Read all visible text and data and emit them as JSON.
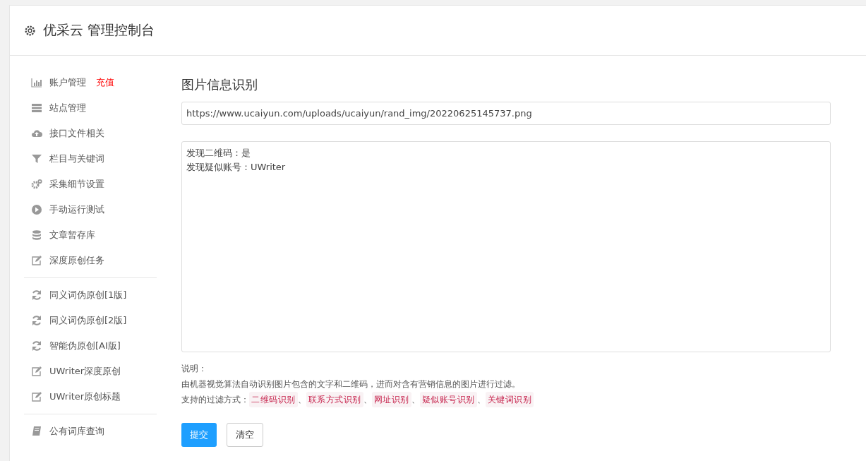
{
  "header": {
    "title": "优采云 管理控制台"
  },
  "sidebar": {
    "groups": [
      [
        {
          "label": "账户管理",
          "badge": "充值"
        },
        {
          "label": "站点管理"
        },
        {
          "label": "接口文件相关"
        },
        {
          "label": "栏目与关键词"
        },
        {
          "label": "采集细节设置"
        },
        {
          "label": "手动运行测试"
        },
        {
          "label": "文章暂存库"
        },
        {
          "label": "深度原创任务"
        }
      ],
      [
        {
          "label": "同义词伪原创[1版]"
        },
        {
          "label": "同义词伪原创[2版]"
        },
        {
          "label": "智能伪原创[AI版]"
        },
        {
          "label": "UWriter深度原创"
        },
        {
          "label": "UWriter原创标题"
        }
      ],
      [
        {
          "label": "公有词库查询"
        }
      ]
    ]
  },
  "main": {
    "title": "图片信息识别",
    "url_field": {
      "value": "https://www.ucaiyun.com/uploads/ucaiyun/rand_img/20220625145737.png"
    },
    "result_lines": [
      "发现二维码：是",
      "发现疑似账号：UWriter"
    ],
    "note_label": "说明：",
    "note_text": "由机器视觉算法自动识别图片包含的文字和二维码，进而对含有营销信息的图片进行过滤。",
    "filter_label": "支持的过滤方式：",
    "filter_parts": [
      {
        "kind": "tag",
        "text": "二维码识别"
      },
      {
        "kind": "sep",
        "text": "、"
      },
      {
        "kind": "tag",
        "text": "联系方式识别"
      },
      {
        "kind": "sep",
        "text": "、"
      },
      {
        "kind": "tag",
        "text": "网址识别"
      },
      {
        "kind": "sep",
        "text": "、"
      },
      {
        "kind": "tag",
        "text": "疑似账号识别"
      },
      {
        "kind": "sep",
        "text": "、"
      },
      {
        "kind": "tag",
        "text": "关键词识别"
      }
    ],
    "buttons": [
      {
        "label": "提交",
        "kind": "primary"
      },
      {
        "label": "清空",
        "kind": "default"
      }
    ]
  }
}
